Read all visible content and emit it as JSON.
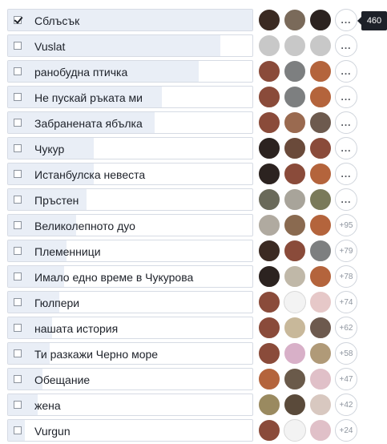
{
  "poll": {
    "tooltip": "460",
    "options": [
      {
        "label": "Сблъсък",
        "checked": true,
        "share": 1.0,
        "more": "...",
        "avatars": [
          "#3b2a22",
          "#7a6a5a",
          "#2c2320"
        ]
      },
      {
        "label": "Vuslat",
        "checked": false,
        "share": 0.87,
        "more": "...",
        "avatars": []
      },
      {
        "label": "ранобудна птичка",
        "checked": false,
        "share": 0.78,
        "more": "...",
        "avatars": [
          "#8a4b3a",
          "#7d7f80",
          "#b4643c"
        ]
      },
      {
        "label": "Не пускай ръката ми",
        "checked": false,
        "share": 0.63,
        "more": "...",
        "avatars": [
          "#8a4b3a",
          "#7d7f80",
          "#b4643c"
        ]
      },
      {
        "label": "Забранената ябълка",
        "checked": false,
        "share": 0.6,
        "more": "...",
        "avatars": [
          "#8a4b3a",
          "#9a6a50",
          "#6d5a4e"
        ]
      },
      {
        "label": "Чукур",
        "checked": false,
        "share": 0.35,
        "more": "...",
        "avatars": [
          "#2c2320",
          "#6a4a3a",
          "#8a4b3a"
        ]
      },
      {
        "label": "Истанбулска невеста",
        "checked": false,
        "share": 0.35,
        "more": "...",
        "avatars": [
          "#2c2320",
          "#8a4b3a",
          "#b4643c"
        ]
      },
      {
        "label": "Пръстен",
        "checked": false,
        "share": 0.32,
        "more": "...",
        "avatars": [
          "#6a6a5a",
          "#a8a49a",
          "#7a7a5a"
        ]
      },
      {
        "label": "Великолепното дуо",
        "checked": false,
        "share": 0.28,
        "more": "+95",
        "avatars": [
          "#b0aaa0",
          "#8a6a50",
          "#b4643c"
        ]
      },
      {
        "label": "Племенници",
        "checked": false,
        "share": 0.24,
        "more": "+79",
        "avatars": [
          "#3b2a22",
          "#8a4b3a",
          "#7d7f80"
        ]
      },
      {
        "label": "Имало едно време в Чукурова",
        "checked": false,
        "share": 0.23,
        "more": "+78",
        "avatars": [
          "#2c2320",
          "#c0b8a8",
          "#b4643c"
        ]
      },
      {
        "label": "Гюлпери",
        "checked": false,
        "share": 0.21,
        "more": "+74",
        "avatars": [
          "#8a4b3a",
          "blank",
          "#e6c8c8"
        ]
      },
      {
        "label": "нашата история",
        "checked": false,
        "share": 0.18,
        "more": "+62",
        "avatars": [
          "#8a4b3a",
          "#c8b89a",
          "#6d5a4e"
        ]
      },
      {
        "label": "Ти разкажи Черно море",
        "checked": false,
        "share": 0.17,
        "more": "+58",
        "avatars": [
          "#8a4b3a",
          "#d8b0c8",
          "#b09a78"
        ]
      },
      {
        "label": "Обещание",
        "checked": false,
        "share": 0.14,
        "more": "+47",
        "avatars": [
          "#b4643c",
          "#6a5a4a",
          "#e0c0c8"
        ]
      },
      {
        "label": "жена",
        "checked": false,
        "share": 0.12,
        "more": "+42",
        "avatars": [
          "#9a8a60",
          "#5a4a3a",
          "#d8c8c0"
        ]
      },
      {
        "label": "Vurgun",
        "checked": false,
        "share": 0.07,
        "more": "+24",
        "avatars": [
          "#8a4b3a",
          "blank",
          "#e0c0c8"
        ]
      }
    ]
  }
}
